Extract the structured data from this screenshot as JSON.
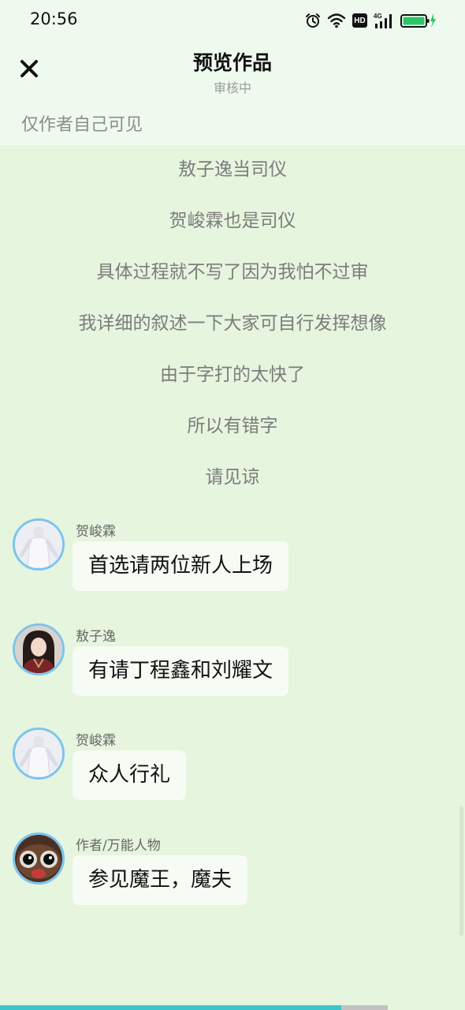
{
  "status_bar": {
    "time": "20:56",
    "icons": [
      "alarm-icon",
      "wifi-icon",
      "hd-icon",
      "signal-4g-icon",
      "battery-charging-icon"
    ],
    "hd_label": "HD",
    "network_label": "4G",
    "battery_percent": 100,
    "battery_color": "#2fc46a"
  },
  "header": {
    "close_icon": "close-icon",
    "title": "预览作品",
    "subtitle": "审核中",
    "visibility_note": "仅作者自己可见"
  },
  "narration": [
    "敖子逸当司仪",
    "贺峻霖也是司仪",
    "具体过程就不写了因为我怕不过审",
    "我详细的叙述一下大家可自行发挥想像",
    "由于字打的太快了",
    "所以有错字",
    "请见谅"
  ],
  "messages": [
    {
      "sender": "贺峻霖",
      "text": "首选请两位新人上场",
      "avatar": "avatar-white-robe"
    },
    {
      "sender": "敖子逸",
      "text": "有请丁程鑫和刘耀文",
      "avatar": "avatar-red-costume"
    },
    {
      "sender": "贺峻霖",
      "text": "众人行礼",
      "avatar": "avatar-white-robe"
    },
    {
      "sender": "作者/万能人物",
      "text": "参见魔王，魔夫",
      "avatar": "avatar-cartoon-face"
    }
  ],
  "reading_progress": 0.88,
  "colors": {
    "background": "#e6f5de",
    "header_background": "#effaef",
    "bubble": "#f6fcf3",
    "avatar_ring": "#7cc4ee",
    "progress_fill": "#3cc6cc"
  }
}
